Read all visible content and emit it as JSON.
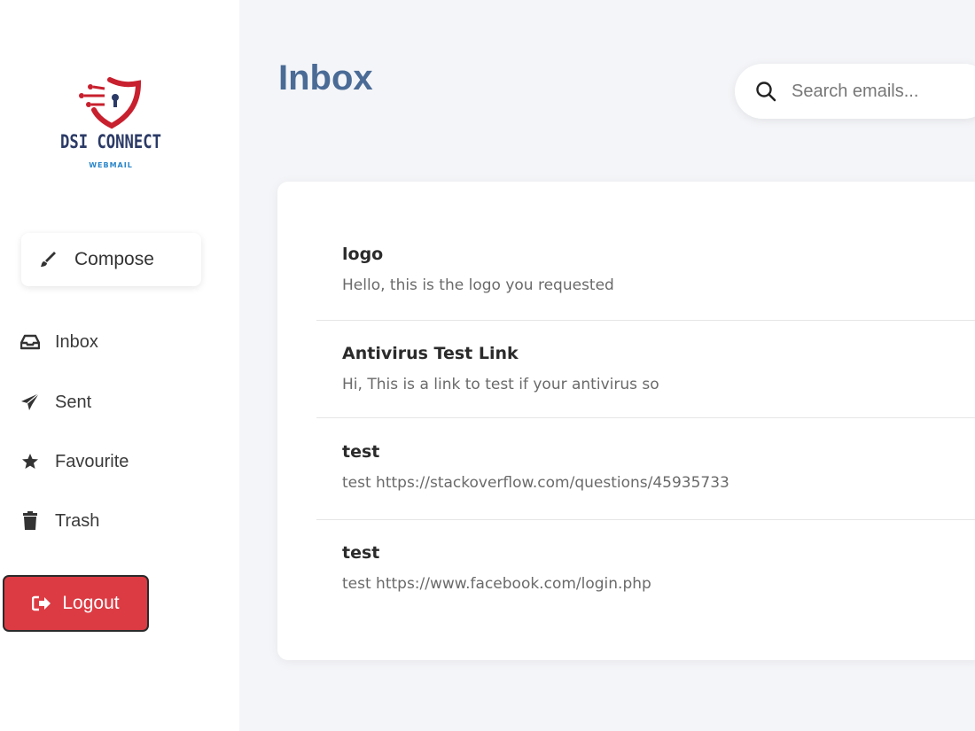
{
  "brand": {
    "name": "DSI CONNECT",
    "subtitle": "WEBMAIL",
    "colors": {
      "shield": "#c8202e",
      "name": "#2b3a66",
      "sub": "#2a86c9"
    }
  },
  "sidebar": {
    "compose_label": "Compose",
    "items": [
      {
        "label": "Inbox",
        "icon": "inbox-icon"
      },
      {
        "label": "Sent",
        "icon": "paper-plane-icon"
      },
      {
        "label": "Favourite",
        "icon": "star-icon"
      },
      {
        "label": "Trash",
        "icon": "trash-icon"
      }
    ],
    "logout_label": "Logout"
  },
  "header": {
    "title": "Inbox",
    "search_placeholder": "Search emails..."
  },
  "emails": [
    {
      "subject": "logo",
      "preview": "Hello, this is the logo you requested"
    },
    {
      "subject": "Antivirus Test Link",
      "preview": "Hi, This is a link to test if your antivirus so"
    },
    {
      "subject": "test",
      "preview": "test https://stackoverflow.com/questions/45935733"
    },
    {
      "subject": "test",
      "preview": "test https://www.facebook.com/login.php"
    }
  ],
  "colors": {
    "accent_title": "#4a6b96",
    "logout_bg": "#dc3b43",
    "background": "#f4f5f8"
  }
}
